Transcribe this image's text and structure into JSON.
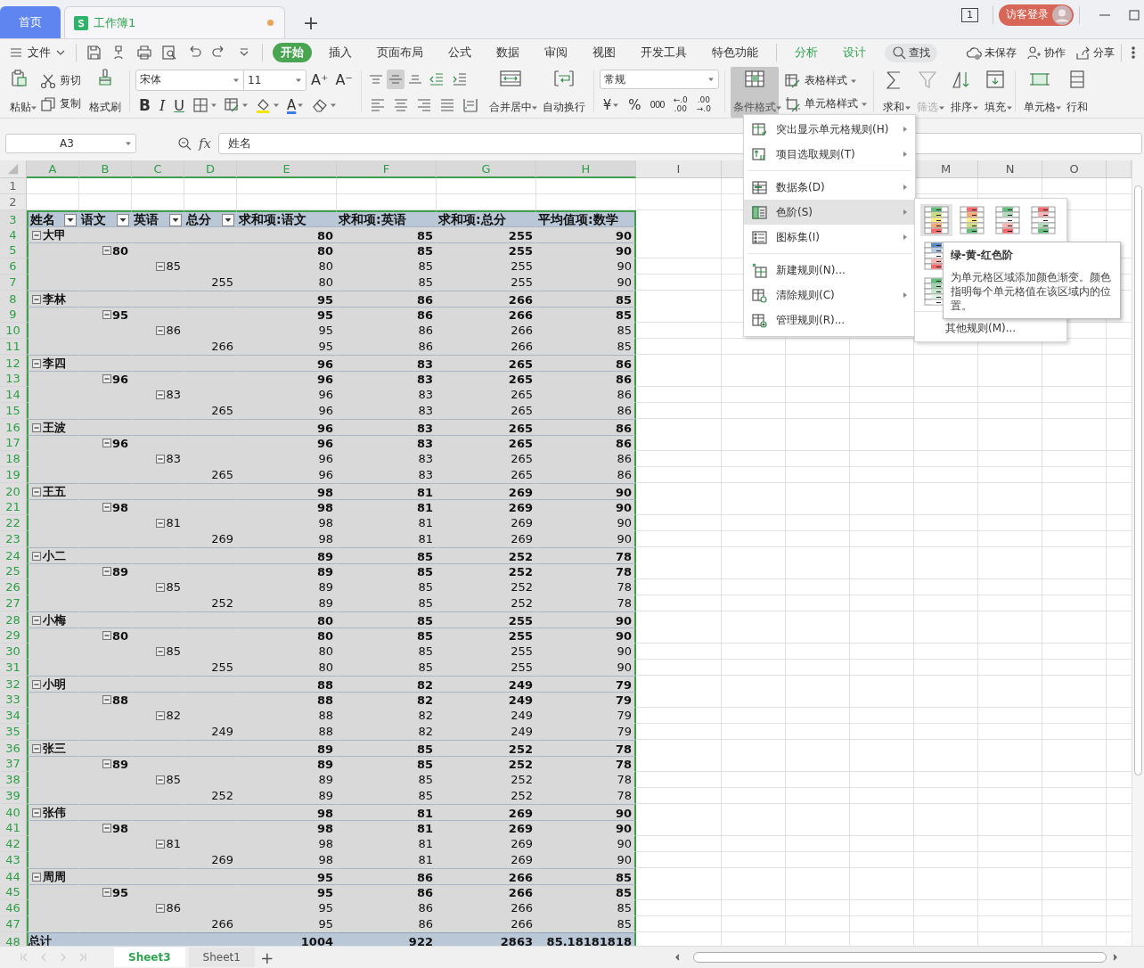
{
  "title_bar": {
    "tabs": [
      {
        "label": "首页",
        "selected": false,
        "kind": "home"
      },
      {
        "label": "工作簿1",
        "selected": true,
        "kind": "document",
        "unsaved": true
      }
    ],
    "new_tab": "+",
    "window_count": "1",
    "account": "访客登录"
  },
  "menu_bar": {
    "file": "文件",
    "tabs": [
      {
        "label": "开始",
        "selected": true,
        "kind": "main"
      },
      {
        "label": "插入",
        "selected": false,
        "kind": "main"
      },
      {
        "label": "页面布局",
        "selected": false,
        "kind": "main"
      },
      {
        "label": "公式",
        "selected": false,
        "kind": "main"
      },
      {
        "label": "数据",
        "selected": false,
        "kind": "main"
      },
      {
        "label": "审阅",
        "selected": false,
        "kind": "main"
      },
      {
        "label": "视图",
        "selected": false,
        "kind": "main"
      },
      {
        "label": "开发工具",
        "selected": false,
        "kind": "main"
      },
      {
        "label": "特色功能",
        "selected": false,
        "kind": "main"
      },
      {
        "label": "分析",
        "selected": false,
        "kind": "context"
      },
      {
        "label": "设计",
        "selected": false,
        "kind": "context"
      }
    ],
    "search": "查找",
    "save_status": "未保存",
    "collaborate": "协作",
    "share": "分享"
  },
  "ribbon": {
    "paste": "粘贴",
    "cut": "剪切",
    "copy": "复制",
    "format_painter": "格式刷",
    "font_name": "宋体",
    "font_size": "11",
    "grow_font": "A⁺",
    "shrink_font": "A⁻",
    "bold": "B",
    "italic": "I",
    "underline": "U",
    "font_color": "A",
    "vertical_align": [
      {
        "selected": false
      },
      {
        "selected": true
      },
      {
        "selected": false
      }
    ],
    "merge_center": "合并居中",
    "wrap_text": "自动换行",
    "number_format": "常规",
    "currency": "¥",
    "percent": "%",
    "thousands": "000",
    "increase_decimal": [
      "←.0",
      ".00"
    ],
    "decrease_decimal": [
      ".00",
      "→.0"
    ],
    "conditional_format": {
      "label": "条件格式",
      "active": true
    },
    "table_style": "表格样式",
    "cell_style": "单元格样式",
    "sum": {
      "label": "求和",
      "disabled": false
    },
    "filter": {
      "label": "筛选",
      "disabled": true
    },
    "sort": {
      "label": "排序",
      "disabled": false
    },
    "fill": {
      "label": "填充",
      "disabled": false
    },
    "cells": "单元格",
    "rows_columns": "行和"
  },
  "formula_bar": {
    "cell_ref": "A3",
    "function_label": "fx",
    "value": "姓名"
  },
  "sheet": {
    "columns": [
      {
        "label": "A",
        "selected": true
      },
      {
        "label": "B",
        "selected": true
      },
      {
        "label": "C",
        "selected": true
      },
      {
        "label": "D",
        "selected": true
      },
      {
        "label": "E",
        "selected": true
      },
      {
        "label": "F",
        "selected": true
      },
      {
        "label": "G",
        "selected": true
      },
      {
        "label": "H",
        "selected": true
      },
      {
        "label": "I",
        "selected": false
      }
    ],
    "columns_right": [
      {
        "label": "M",
        "selected": false
      },
      {
        "label": "N",
        "selected": false
      },
      {
        "label": "O",
        "selected": false
      }
    ],
    "rows": [
      {
        "label": "1",
        "selected": false
      },
      {
        "label": "2",
        "selected": false
      },
      {
        "label": "3",
        "selected": true
      },
      {
        "label": "4",
        "selected": true
      },
      {
        "label": "5",
        "selected": true
      },
      {
        "label": "6",
        "selected": true
      },
      {
        "label": "7",
        "selected": true
      },
      {
        "label": "8",
        "selected": true
      },
      {
        "label": "9",
        "selected": true
      },
      {
        "label": "10",
        "selected": true
      },
      {
        "label": "11",
        "selected": true
      },
      {
        "label": "12",
        "selected": true
      },
      {
        "label": "13",
        "selected": true
      },
      {
        "label": "14",
        "selected": true
      },
      {
        "label": "15",
        "selected": true
      },
      {
        "label": "16",
        "selected": true
      },
      {
        "label": "17",
        "selected": true
      },
      {
        "label": "18",
        "selected": true
      },
      {
        "label": "19",
        "selected": true
      },
      {
        "label": "20",
        "selected": true
      },
      {
        "label": "21",
        "selected": true
      },
      {
        "label": "22",
        "selected": true
      },
      {
        "label": "23",
        "selected": true
      },
      {
        "label": "24",
        "selected": true
      },
      {
        "label": "25",
        "selected": true
      },
      {
        "label": "26",
        "selected": true
      },
      {
        "label": "27",
        "selected": true
      },
      {
        "label": "28",
        "selected": true
      },
      {
        "label": "29",
        "selected": true
      },
      {
        "label": "30",
        "selected": true
      },
      {
        "label": "31",
        "selected": true
      },
      {
        "label": "32",
        "selected": true
      },
      {
        "label": "33",
        "selected": true
      },
      {
        "label": "34",
        "selected": true
      },
      {
        "label": "35",
        "selected": true
      },
      {
        "label": "36",
        "selected": true
      },
      {
        "label": "37",
        "selected": true
      },
      {
        "label": "38",
        "selected": true
      },
      {
        "label": "39",
        "selected": true
      },
      {
        "label": "40",
        "selected": true
      },
      {
        "label": "41",
        "selected": true
      },
      {
        "label": "42",
        "selected": true
      },
      {
        "label": "43",
        "selected": true
      },
      {
        "label": "44",
        "selected": true
      },
      {
        "label": "45",
        "selected": true
      },
      {
        "label": "46",
        "selected": true
      },
      {
        "label": "47",
        "selected": true
      },
      {
        "label": "48",
        "selected": true
      }
    ],
    "pivot": {
      "header": [
        {
          "label": "姓名",
          "filter": true
        },
        {
          "label": "语文",
          "filter": true
        },
        {
          "label": "英语",
          "filter": true
        },
        {
          "label": "总分",
          "filter": true
        },
        {
          "label": "求和项:语文",
          "filter": false
        },
        {
          "label": "求和项:英语",
          "filter": false
        },
        {
          "label": "求和项:总分",
          "filter": false
        },
        {
          "label": "平均值项:数学",
          "filter": false
        }
      ],
      "groups": [
        {
          "label": "大甲",
          "expanded": true,
          "values": [
            "80",
            "85",
            "255",
            "90"
          ],
          "children": [
            {
              "label": "80",
              "expanded": true,
              "values": [
                "80",
                "85",
                "255",
                "90"
              ],
              "children": [
                {
                  "label": "85",
                  "expanded": true,
                  "values": [
                    "80",
                    "85",
                    "255",
                    "90"
                  ],
                  "children": [
                    {
                      "label": "255",
                      "values": [
                        "80",
                        "85",
                        "255",
                        "90"
                      ]
                    }
                  ]
                }
              ]
            }
          ]
        },
        {
          "label": "李林",
          "expanded": true,
          "values": [
            "95",
            "86",
            "266",
            "85"
          ],
          "children": [
            {
              "label": "95",
              "expanded": true,
              "values": [
                "95",
                "86",
                "266",
                "85"
              ],
              "children": [
                {
                  "label": "86",
                  "expanded": true,
                  "values": [
                    "95",
                    "86",
                    "266",
                    "85"
                  ],
                  "children": [
                    {
                      "label": "266",
                      "values": [
                        "95",
                        "86",
                        "266",
                        "85"
                      ]
                    }
                  ]
                }
              ]
            }
          ]
        },
        {
          "label": "李四",
          "expanded": true,
          "values": [
            "96",
            "83",
            "265",
            "86"
          ],
          "children": [
            {
              "label": "96",
              "expanded": true,
              "values": [
                "96",
                "83",
                "265",
                "86"
              ],
              "children": [
                {
                  "label": "83",
                  "expanded": true,
                  "values": [
                    "96",
                    "83",
                    "265",
                    "86"
                  ],
                  "children": [
                    {
                      "label": "265",
                      "values": [
                        "96",
                        "83",
                        "265",
                        "86"
                      ]
                    }
                  ]
                }
              ]
            }
          ]
        },
        {
          "label": "王波",
          "expanded": true,
          "values": [
            "96",
            "83",
            "265",
            "86"
          ],
          "children": [
            {
              "label": "96",
              "expanded": true,
              "values": [
                "96",
                "83",
                "265",
                "86"
              ],
              "children": [
                {
                  "label": "83",
                  "expanded": true,
                  "values": [
                    "96",
                    "83",
                    "265",
                    "86"
                  ],
                  "children": [
                    {
                      "label": "265",
                      "values": [
                        "96",
                        "83",
                        "265",
                        "86"
                      ]
                    }
                  ]
                }
              ]
            }
          ]
        },
        {
          "label": "王五",
          "expanded": true,
          "values": [
            "98",
            "81",
            "269",
            "90"
          ],
          "children": [
            {
              "label": "98",
              "expanded": true,
              "values": [
                "98",
                "81",
                "269",
                "90"
              ],
              "children": [
                {
                  "label": "81",
                  "expanded": true,
                  "values": [
                    "98",
                    "81",
                    "269",
                    "90"
                  ],
                  "children": [
                    {
                      "label": "269",
                      "values": [
                        "98",
                        "81",
                        "269",
                        "90"
                      ]
                    }
                  ]
                }
              ]
            }
          ]
        },
        {
          "label": "小二",
          "expanded": true,
          "values": [
            "89",
            "85",
            "252",
            "78"
          ],
          "children": [
            {
              "label": "89",
              "expanded": true,
              "values": [
                "89",
                "85",
                "252",
                "78"
              ],
              "children": [
                {
                  "label": "85",
                  "expanded": true,
                  "values": [
                    "89",
                    "85",
                    "252",
                    "78"
                  ],
                  "children": [
                    {
                      "label": "252",
                      "values": [
                        "89",
                        "85",
                        "252",
                        "78"
                      ]
                    }
                  ]
                }
              ]
            }
          ]
        },
        {
          "label": "小梅",
          "expanded": true,
          "values": [
            "80",
            "85",
            "255",
            "90"
          ],
          "children": [
            {
              "label": "80",
              "expanded": true,
              "values": [
                "80",
                "85",
                "255",
                "90"
              ],
              "children": [
                {
                  "label": "85",
                  "expanded": true,
                  "values": [
                    "80",
                    "85",
                    "255",
                    "90"
                  ],
                  "children": [
                    {
                      "label": "255",
                      "values": [
                        "80",
                        "85",
                        "255",
                        "90"
                      ]
                    }
                  ]
                }
              ]
            }
          ]
        },
        {
          "label": "小明",
          "expanded": true,
          "values": [
            "88",
            "82",
            "249",
            "79"
          ],
          "children": [
            {
              "label": "88",
              "expanded": true,
              "values": [
                "88",
                "82",
                "249",
                "79"
              ],
              "children": [
                {
                  "label": "82",
                  "expanded": true,
                  "values": [
                    "88",
                    "82",
                    "249",
                    "79"
                  ],
                  "children": [
                    {
                      "label": "249",
                      "values": [
                        "88",
                        "82",
                        "249",
                        "79"
                      ]
                    }
                  ]
                }
              ]
            }
          ]
        },
        {
          "label": "张三",
          "expanded": true,
          "values": [
            "89",
            "85",
            "252",
            "78"
          ],
          "children": [
            {
              "label": "89",
              "expanded": true,
              "values": [
                "89",
                "85",
                "252",
                "78"
              ],
              "children": [
                {
                  "label": "85",
                  "expanded": true,
                  "values": [
                    "89",
                    "85",
                    "252",
                    "78"
                  ],
                  "children": [
                    {
                      "label": "252",
                      "values": [
                        "89",
                        "85",
                        "252",
                        "78"
                      ]
                    }
                  ]
                }
              ]
            }
          ]
        },
        {
          "label": "张伟",
          "expanded": true,
          "values": [
            "98",
            "81",
            "269",
            "90"
          ],
          "children": [
            {
              "label": "98",
              "expanded": true,
              "values": [
                "98",
                "81",
                "269",
                "90"
              ],
              "children": [
                {
                  "label": "81",
                  "expanded": true,
                  "values": [
                    "98",
                    "81",
                    "269",
                    "90"
                  ],
                  "children": [
                    {
                      "label": "269",
                      "values": [
                        "98",
                        "81",
                        "269",
                        "90"
                      ]
                    }
                  ]
                }
              ]
            }
          ]
        },
        {
          "label": "周周",
          "expanded": true,
          "values": [
            "95",
            "86",
            "266",
            "85"
          ],
          "children": [
            {
              "label": "95",
              "expanded": true,
              "values": [
                "95",
                "86",
                "266",
                "85"
              ],
              "children": [
                {
                  "label": "86",
                  "expanded": true,
                  "values": [
                    "95",
                    "86",
                    "266",
                    "85"
                  ],
                  "children": [
                    {
                      "label": "266",
                      "values": [
                        "95",
                        "86",
                        "266",
                        "85"
                      ]
                    }
                  ]
                }
              ]
            }
          ]
        }
      ],
      "total": {
        "label": "总计",
        "values": [
          "1004",
          "922",
          "2863",
          "85.18181818"
        ]
      }
    }
  },
  "format_menu": {
    "groups": [
      [
        {
          "label": "突出显示单元格规则(H)",
          "submenu": true,
          "selected": false
        },
        {
          "label": "项目选取规则(T)",
          "submenu": true,
          "selected": false
        }
      ],
      [
        {
          "label": "数据条(D)",
          "submenu": true,
          "selected": false
        },
        {
          "label": "色阶(S)",
          "submenu": true,
          "selected": true
        },
        {
          "label": "图标集(I)",
          "submenu": true,
          "selected": false
        }
      ],
      [
        {
          "label": "新建规则(N)...",
          "submenu": false,
          "selected": false
        },
        {
          "label": "清除规则(C)",
          "submenu": true,
          "selected": false
        },
        {
          "label": "管理规则(R)...",
          "submenu": false,
          "selected": false
        }
      ]
    ]
  },
  "color_scale_menu": {
    "swatches": [
      {
        "selected": true,
        "stripes": [
          {
            "color": "#63be7b"
          },
          {
            "color": "#cddd82"
          },
          {
            "color": "#ffeb84"
          },
          {
            "color": "#fbaa77"
          },
          {
            "color": "#f8696b"
          }
        ]
      },
      {
        "selected": false,
        "stripes": [
          {
            "color": "#f8696b"
          },
          {
            "color": "#fbaa77"
          },
          {
            "color": "#ffeb84"
          },
          {
            "color": "#cddd82"
          },
          {
            "color": "#63be7b"
          }
        ]
      },
      {
        "selected": false,
        "stripes": [
          {
            "color": "#63be7b"
          },
          {
            "color": "#b1dcb9"
          },
          {
            "color": "#fcfcff"
          },
          {
            "color": "#fbb5b6"
          },
          {
            "color": "#f8696b"
          }
        ]
      },
      {
        "selected": false,
        "stripes": [
          {
            "color": "#f8696b"
          },
          {
            "color": "#fbb5b6"
          },
          {
            "color": "#fcfcff"
          },
          {
            "color": "#b1dcb9"
          },
          {
            "color": "#63be7b"
          }
        ]
      },
      {
        "selected": false,
        "stripes": [
          {
            "color": "#5a8ac6"
          },
          {
            "color": "#b3c9e6"
          },
          {
            "color": "#fcfcff"
          },
          {
            "color": "#fbb5b6"
          },
          {
            "color": "#f8696b"
          }
        ]
      },
      {
        "selected": false,
        "stripes": [
          {
            "color": "#63be7b"
          },
          {
            "color": "#9fd3ac"
          },
          {
            "color": "#c6e6cd"
          },
          {
            "color": "#e3f2e6"
          },
          {
            "color": "#fcfcff"
          }
        ]
      }
    ],
    "more": "其他规则(M)..."
  },
  "tooltip": {
    "title": "绿-黄-红色阶",
    "text": "为单元格区域添加颜色渐变。颜色指明每个单元格值在该区域内的位置。"
  },
  "sheet_tabs": [
    {
      "label": "Sheet3",
      "selected": true
    },
    {
      "label": "Sheet1",
      "selected": false
    }
  ],
  "add_sheet": "+"
}
